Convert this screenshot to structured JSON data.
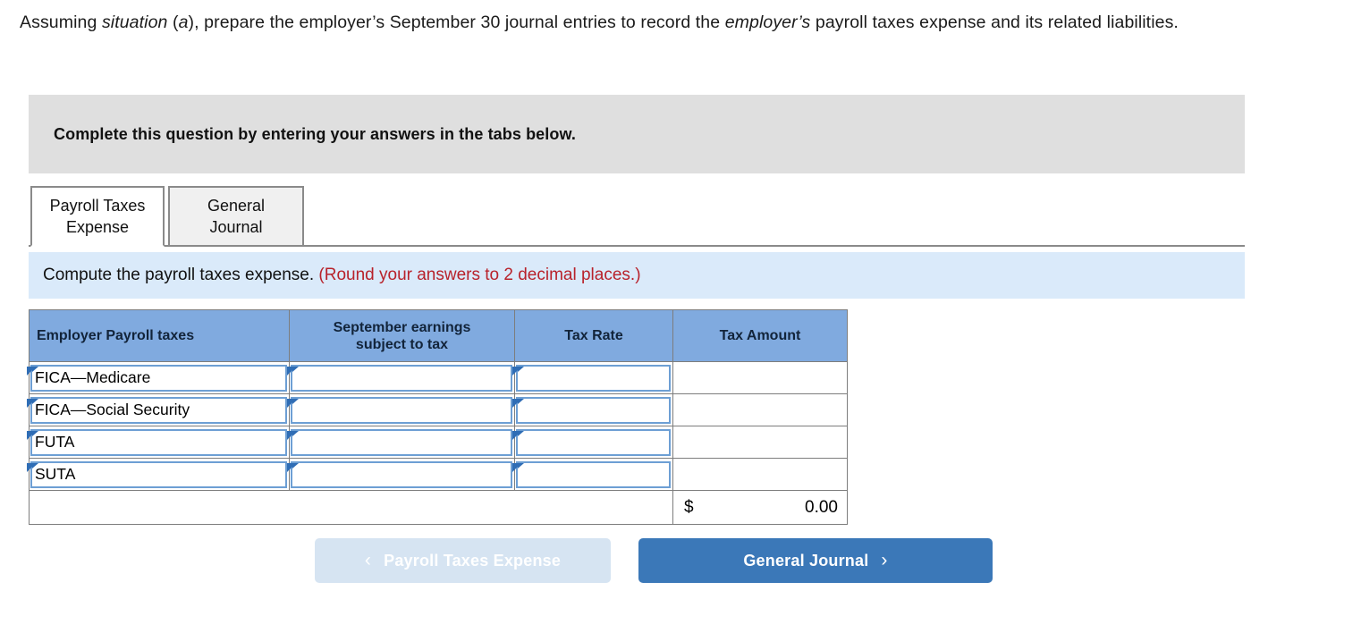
{
  "prompt": {
    "part1": "Assuming ",
    "em1": "situation",
    "part2": " (",
    "em2": "a",
    "part3": "), prepare the employer’s September 30 journal entries to record the ",
    "em3": "employer’s",
    "part4": " payroll taxes expense and its related liabilities."
  },
  "banner": {
    "text": "Complete this question by entering your answers in the tabs below."
  },
  "tabs": [
    {
      "label_line1": "Payroll Taxes",
      "label_line2": "Expense",
      "active": true
    },
    {
      "label_line1": "General",
      "label_line2": "Journal",
      "active": false
    }
  ],
  "instruction": {
    "text": "Compute the payroll taxes expense.",
    "note": "(Round your answers to 2 decimal places.)"
  },
  "table": {
    "headers": [
      "Employer Payroll taxes",
      "September earnings subject to tax",
      "Tax Rate",
      "Tax Amount"
    ],
    "header_wrapped": {
      "col2_line1": "September earnings",
      "col2_line2": "subject to tax"
    },
    "rows": [
      {
        "name": "FICA—Medicare",
        "earnings": "",
        "rate": "",
        "amount": ""
      },
      {
        "name": "FICA—Social Security",
        "earnings": "",
        "rate": "",
        "amount": ""
      },
      {
        "name": "FUTA",
        "earnings": "",
        "rate": "",
        "amount": ""
      },
      {
        "name": "SUTA",
        "earnings": "",
        "rate": "",
        "amount": ""
      }
    ],
    "total": {
      "currency": "$",
      "value": "0.00"
    }
  },
  "nav": {
    "prev_label": "Payroll Taxes Expense",
    "prev_icon": "‹",
    "next_label": "General Journal",
    "next_icon": "›"
  },
  "colors": {
    "header_blue": "#80aadf",
    "instruction_blue": "#daeafa",
    "note_red": "#b8222b",
    "banner_gray": "#dfdfdf",
    "button_blue": "#3b78b8",
    "button_disabled": "#d6e4f2",
    "input_border": "#6d9fd4"
  }
}
